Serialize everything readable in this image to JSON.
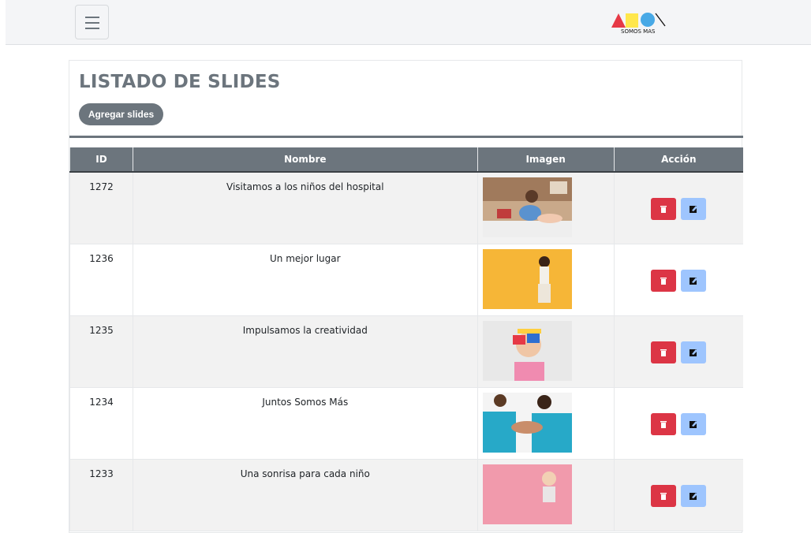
{
  "navbar": {
    "menu_icon": "hamburger-menu-icon",
    "logo_text": "SOMOS MAS",
    "logo_colors": [
      "#e63946",
      "#ffe74c",
      "#48a9e6"
    ]
  },
  "page": {
    "title": "LISTADO DE SLIDES",
    "add_button": "Agregar slides"
  },
  "table": {
    "headers": {
      "id": "ID",
      "name": "Nombre",
      "image": "Imagen",
      "action": "Acción"
    },
    "rows": [
      {
        "id": "1272",
        "name": "Visitamos a los niños del hospital",
        "image": "child-with-doctor-toy-photo"
      },
      {
        "id": "1236",
        "name": "Un mejor lugar",
        "image": "girl-on-yellow-background-photo"
      },
      {
        "id": "1235",
        "name": "Impulsamos la creatividad",
        "image": "girl-with-painted-hands-photo"
      },
      {
        "id": "1234",
        "name": "Juntos Somos Más",
        "image": "team-hands-together-photo"
      },
      {
        "id": "1233",
        "name": "Una sonrisa para cada niño",
        "image": "child-on-pink-background-photo"
      }
    ],
    "delete_icon": "trash-icon",
    "edit_icon": "edit-icon",
    "colors": {
      "header": "#6c757d",
      "delete": "#dc3545",
      "edit": "#9ec5fe"
    }
  }
}
